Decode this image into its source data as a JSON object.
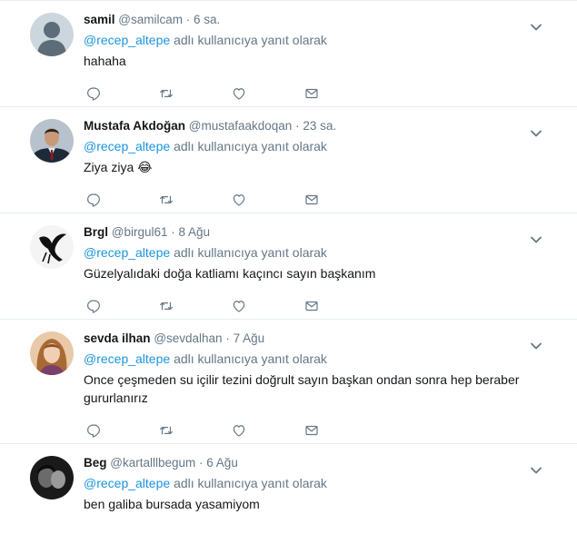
{
  "reply_phrase": "adlı kullanıcıya yanıt olarak",
  "tweets": [
    {
      "name": "samil",
      "handle": "@samilcam",
      "time": "· 6 sa.",
      "reply_to": "@recep_altepe",
      "text": "hahaha"
    },
    {
      "name": "Mustafa Akdoğan",
      "handle": "@mustafaakdoqan",
      "time": "· 23 sa.",
      "reply_to": "@recep_altepe",
      "text": "Ziya ziya 😂"
    },
    {
      "name": "Brgl",
      "handle": "@birgul61",
      "time": "· 8 Ağu",
      "reply_to": "@recep_altepe",
      "text": "Güzelyalıdaki doğa katliamı kaçıncı sayın başkanım"
    },
    {
      "name": "sevda ilhan",
      "handle": "@sevdalhan",
      "time": "· 7 Ağu",
      "reply_to": "@recep_altepe",
      "text": "Once çeşmeden su içilir tezini doğrult sayın başkan ondan sonra hep beraber gururlanırız"
    },
    {
      "name": "Beg",
      "handle": "@kartalllbegum",
      "time": "· 6 Ağu",
      "reply_to": "@recep_altepe",
      "text": "ben galiba bursada yasamiyom"
    }
  ],
  "colors": {
    "link": "#1b95e0",
    "muted": "#657786",
    "text": "#14171a",
    "border": "#e6ecf0"
  },
  "icons": [
    "reply-icon",
    "retweet-icon",
    "like-icon",
    "direct-message-icon",
    "chevron-down-icon"
  ]
}
